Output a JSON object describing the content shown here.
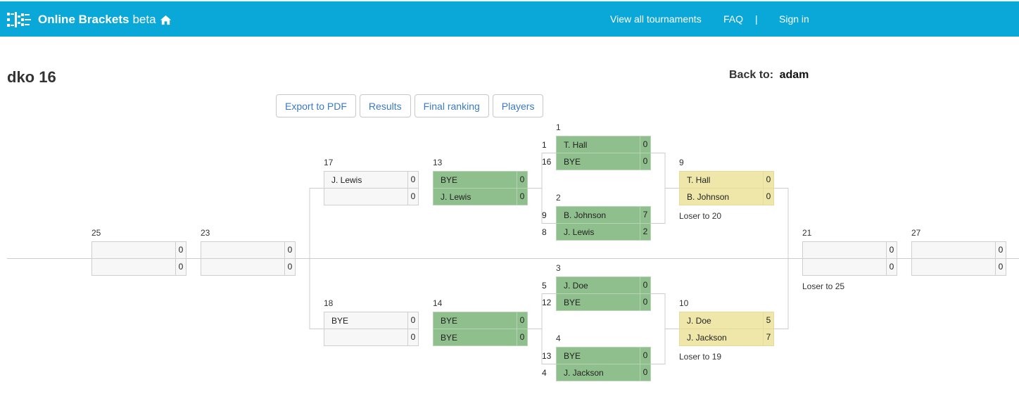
{
  "header": {
    "brand": "Online Brackets",
    "beta": "beta",
    "nav": {
      "view_all": "View all tournaments",
      "faq": "FAQ",
      "separator": "|",
      "sign_in": "Sign in"
    }
  },
  "page": {
    "title": "dko 16",
    "back_label": "Back to:",
    "back_link": "adam"
  },
  "buttons": {
    "export": "Export to PDF",
    "results": "Results",
    "ranking": "Final ranking",
    "players": "Players"
  },
  "colors": {
    "header": "#0aa8d8",
    "winners": "#8fbf8c",
    "pending": "#efe7a9",
    "link": "#3a7ac4"
  },
  "matches": {
    "m1": {
      "num": "1",
      "p1": {
        "seed": "1",
        "name": "T. Hall",
        "score": "0"
      },
      "p2": {
        "seed": "16",
        "name": "BYE",
        "score": "0"
      }
    },
    "m2": {
      "num": "2",
      "p1": {
        "seed": "9",
        "name": "B. Johnson",
        "score": "7"
      },
      "p2": {
        "seed": "8",
        "name": "J. Lewis",
        "score": "2"
      }
    },
    "m3": {
      "num": "3",
      "p1": {
        "seed": "5",
        "name": "J. Doe",
        "score": "0"
      },
      "p2": {
        "seed": "12",
        "name": "BYE",
        "score": "0"
      }
    },
    "m4": {
      "num": "4",
      "p1": {
        "seed": "13",
        "name": "BYE",
        "score": "0"
      },
      "p2": {
        "seed": "4",
        "name": "J. Jackson",
        "score": "0"
      }
    },
    "m9": {
      "num": "9",
      "p1": {
        "name": "T. Hall",
        "score": "0"
      },
      "p2": {
        "name": "B. Johnson",
        "score": "0"
      },
      "note": "Loser to 20"
    },
    "m10": {
      "num": "10",
      "p1": {
        "name": "J. Doe",
        "score": "5"
      },
      "p2": {
        "name": "J. Jackson",
        "score": "7"
      },
      "note": "Loser to 19"
    },
    "m13": {
      "num": "13",
      "p1": {
        "name": "BYE",
        "score": "0"
      },
      "p2": {
        "name": "J. Lewis",
        "score": "0"
      }
    },
    "m14": {
      "num": "14",
      "p1": {
        "name": "BYE",
        "score": "0"
      },
      "p2": {
        "name": "BYE",
        "score": "0"
      }
    },
    "m17": {
      "num": "17",
      "p1": {
        "name": "J. Lewis",
        "score": "0"
      },
      "p2": {
        "name": "",
        "score": "0"
      }
    },
    "m18": {
      "num": "18",
      "p1": {
        "name": "BYE",
        "score": "0"
      },
      "p2": {
        "name": "",
        "score": "0"
      }
    },
    "m21": {
      "num": "21",
      "p1": {
        "name": "",
        "score": "0"
      },
      "p2": {
        "name": "",
        "score": "0"
      },
      "note": "Loser to 25"
    },
    "m23": {
      "num": "23",
      "p1": {
        "name": "",
        "score": "0"
      },
      "p2": {
        "name": "",
        "score": "0"
      }
    },
    "m25": {
      "num": "25",
      "p1": {
        "name": "",
        "score": "0"
      },
      "p2": {
        "name": "",
        "score": "0"
      }
    },
    "m27": {
      "num": "27",
      "p1": {
        "name": "",
        "score": "0"
      },
      "p2": {
        "name": "",
        "score": "0"
      }
    }
  }
}
